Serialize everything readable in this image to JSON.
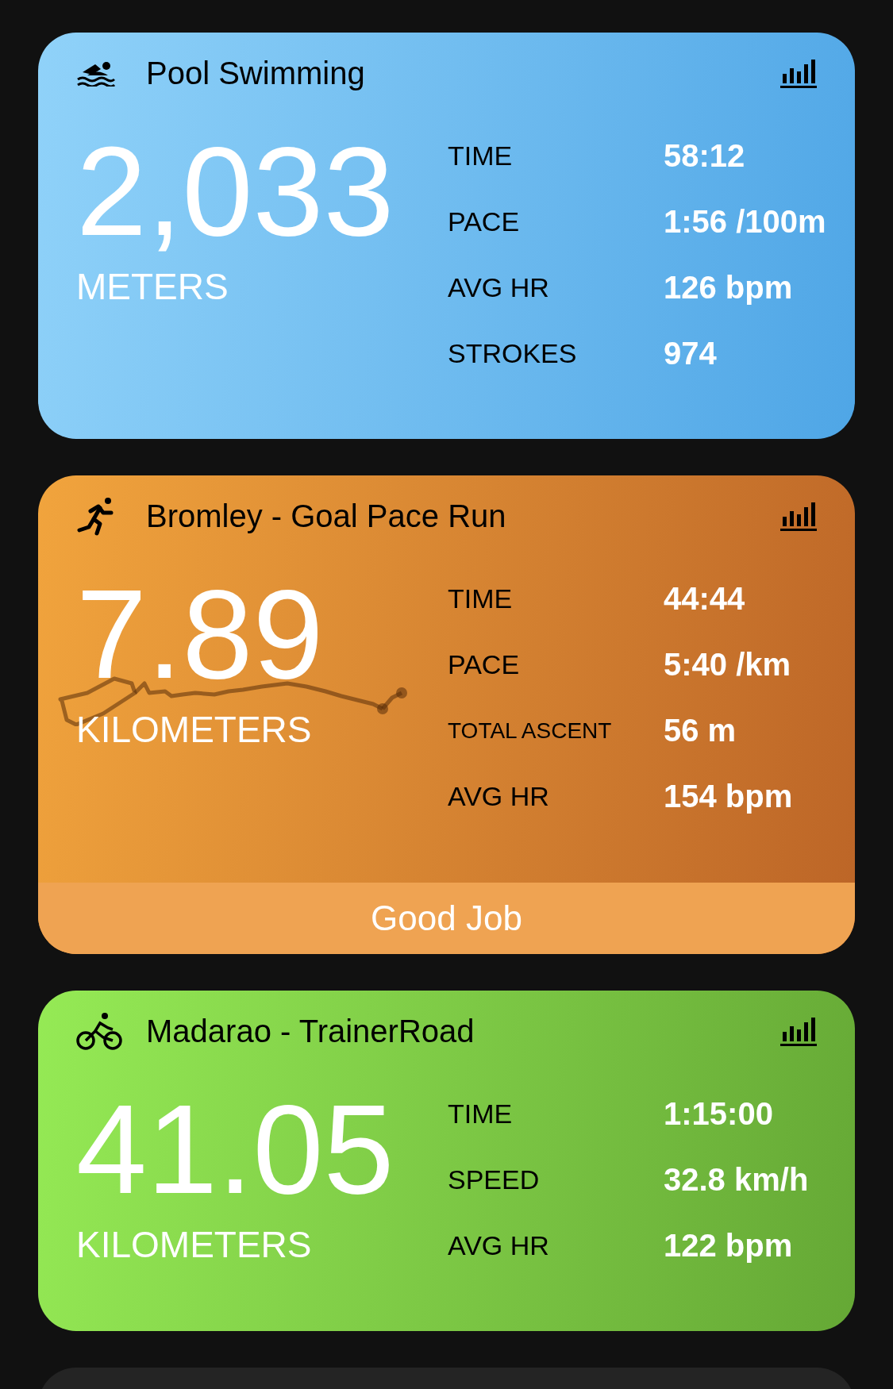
{
  "activities": [
    {
      "kind": "swim",
      "title": "Pool Swimming",
      "distance": "2,033",
      "unit": "METERS",
      "stats": [
        {
          "kind": "normal",
          "label": "TIME",
          "value": "58:12"
        },
        {
          "kind": "normal",
          "label": "PACE",
          "value": "1:56 /100m"
        },
        {
          "kind": "normal",
          "label": "AVG HR",
          "value": "126 bpm"
        },
        {
          "kind": "normal",
          "label": "STROKES",
          "value": "974"
        }
      ]
    },
    {
      "kind": "run",
      "title": "Bromley - Goal Pace Run",
      "distance": "7.89",
      "unit": "KILOMETERS",
      "stats": [
        {
          "kind": "normal",
          "label": "TIME",
          "value": "44:44"
        },
        {
          "kind": "normal",
          "label": "PACE",
          "value": "5:40 /km"
        },
        {
          "kind": "compact",
          "label": "TOTAL ASCENT",
          "value": "56 m"
        },
        {
          "kind": "normal",
          "label": "AVG HR",
          "value": "154 bpm"
        }
      ],
      "footer": "Good Job"
    },
    {
      "kind": "bike",
      "title": "Madarao - TrainerRoad",
      "distance": "41.05",
      "unit": "KILOMETERS",
      "stats": [
        {
          "kind": "normal",
          "label": "TIME",
          "value": "1:15:00"
        },
        {
          "kind": "normal",
          "label": "SPEED",
          "value": "32.8 km/h"
        },
        {
          "kind": "normal",
          "label": "AVG HR",
          "value": "122 bpm"
        }
      ]
    },
    {
      "kind": "partial"
    }
  ]
}
